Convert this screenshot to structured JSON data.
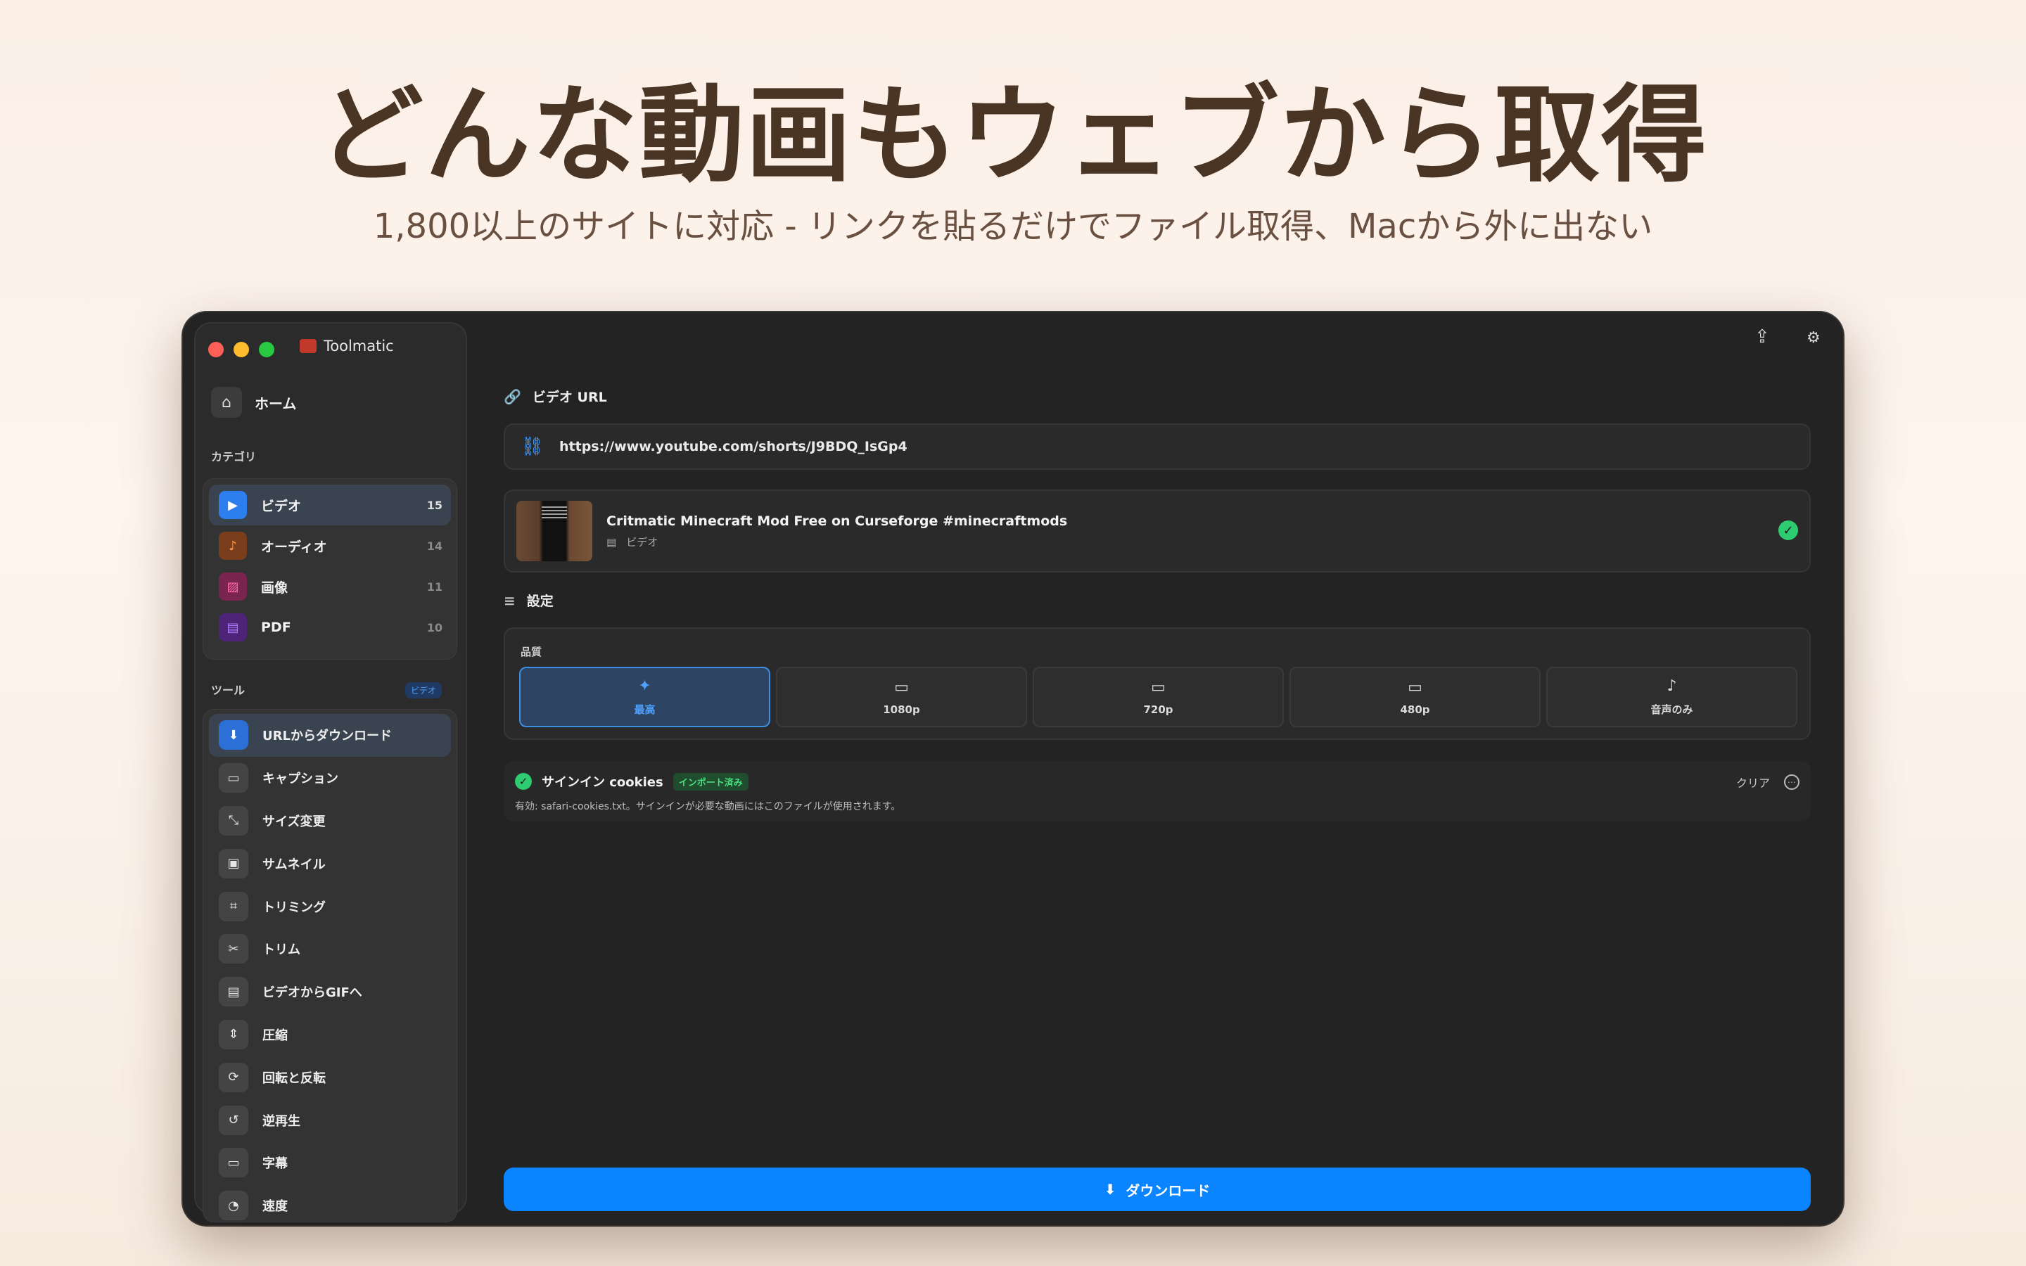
{
  "hero": {
    "headline": "どんな動画もウェブから取得",
    "subhead": "1,800以上のサイトに対応 - リンクを貼るだけでファイル取得、Macから外に出ない"
  },
  "app": {
    "name": "Toolmatic"
  },
  "sidebar": {
    "home_label": "ホーム",
    "categories_label": "カテゴリ",
    "categories": [
      {
        "label": "ビデオ",
        "count": "15",
        "icon": "play-icon",
        "color": "#2d7ff0"
      },
      {
        "label": "オーディオ",
        "count": "14",
        "icon": "music-note-icon",
        "color": "#8a4a22"
      },
      {
        "label": "画像",
        "count": "11",
        "icon": "image-icon",
        "color": "#8a2a5a"
      },
      {
        "label": "PDF",
        "count": "10",
        "icon": "document-icon",
        "color": "#5a2a8a"
      }
    ],
    "tools_label": "ツール",
    "tools_badge": "ビデオ",
    "tools": [
      {
        "label": "URLからダウンロード",
        "icon": "arrow-down-icon",
        "glyph": "⬇"
      },
      {
        "label": "キャプション",
        "icon": "caption-icon",
        "glyph": "💬"
      },
      {
        "label": "サイズ変更",
        "icon": "resize-icon",
        "glyph": "⤡"
      },
      {
        "label": "サムネイル",
        "icon": "thumbnail-icon",
        "glyph": "▣"
      },
      {
        "label": "トリミング",
        "icon": "crop-icon",
        "glyph": "⌗"
      },
      {
        "label": "トリム",
        "icon": "scissors-icon",
        "glyph": "✂"
      },
      {
        "label": "ビデオからGIFへ",
        "icon": "film-icon",
        "glyph": "▤"
      },
      {
        "label": "圧縮",
        "icon": "compress-icon",
        "glyph": "⇕"
      },
      {
        "label": "回転と反転",
        "icon": "rotate-icon",
        "glyph": "⟳"
      },
      {
        "label": "逆再生",
        "icon": "reverse-icon",
        "glyph": "↺"
      },
      {
        "label": "字幕",
        "icon": "subtitle-icon",
        "glyph": "▭"
      },
      {
        "label": "速度",
        "icon": "speed-icon",
        "glyph": "◔"
      }
    ]
  },
  "main": {
    "url_label": "ビデオ URL",
    "url_value": "https://www.youtube.com/shorts/J9BDQ_IsGp4",
    "video": {
      "title": "Critmatic Minecraft Mod Free on Curseforge #minecraftmods",
      "type": "ビデオ"
    },
    "settings_label": "設定",
    "quality_label": "品質",
    "quality_options": [
      {
        "label": "最高",
        "icon": "sparkle-icon",
        "glyph": "✦"
      },
      {
        "label": "1080p",
        "icon": "monitor-icon",
        "glyph": "🖵"
      },
      {
        "label": "720p",
        "icon": "monitor-icon",
        "glyph": "🖵"
      },
      {
        "label": "480p",
        "icon": "monitor-icon",
        "glyph": "🖵"
      },
      {
        "label": "音声のみ",
        "icon": "music-note-icon",
        "glyph": "♪"
      }
    ],
    "quality_selected": "最高",
    "cookies": {
      "title": "サインイン cookies",
      "badge": "インポート済み",
      "description": "有効: safari-cookies.txt。サインインが必要な動画にはこのファイルが使用されます。",
      "clear_label": "クリア"
    },
    "download_label": "ダウンロード"
  }
}
